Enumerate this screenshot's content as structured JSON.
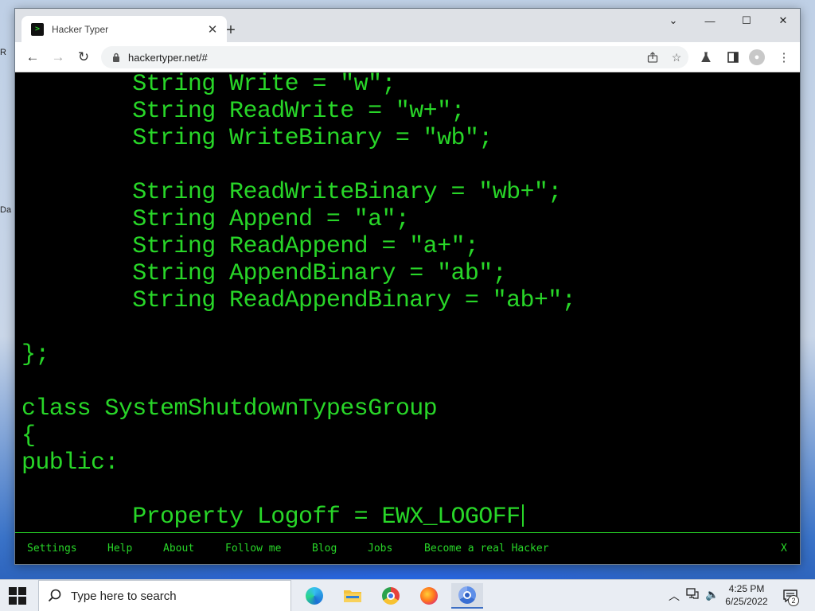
{
  "desktop": {
    "fragments": [
      "R",
      "Da"
    ]
  },
  "browser": {
    "tab_title": "Hacker Typer",
    "favicon_glyph": ">",
    "tab_close": "✕",
    "new_tab": "+",
    "window_controls": {
      "minimize": "—",
      "maximize": "☐",
      "close": "✕",
      "tabs_menu": "⌄"
    },
    "url": "hackertyper.net/#",
    "nav": {
      "back": "←",
      "forward": "→",
      "reload": "↻"
    }
  },
  "terminal": {
    "text_color": "#28d628",
    "lines": [
      "        String Write = \"w\";",
      "        String ReadWrite = \"w+\";",
      "        String WriteBinary = \"wb\";",
      "",
      "        String ReadWriteBinary = \"wb+\";",
      "        String Append = \"a\";",
      "        String ReadAppend = \"a+\";",
      "        String AppendBinary = \"ab\";",
      "        String ReadAppendBinary = \"ab+\";",
      "",
      "};",
      "",
      "class SystemShutdownTypesGroup",
      "{",
      "public:",
      "",
      "        Property Logoff = EWX_LOGOFF"
    ]
  },
  "menu": {
    "items": [
      "Settings",
      "Help",
      "About",
      "Follow me",
      "Blog",
      "Jobs",
      "Become a real Hacker"
    ],
    "close": "X"
  },
  "taskbar": {
    "search_placeholder": "Type here to search",
    "apps": [
      "edge-icon",
      "file-explorer-icon",
      "chrome-icon",
      "firefox-icon",
      "chrome-active-icon"
    ],
    "time": "4:25 PM",
    "date": "6/25/2022",
    "notification_count": "2"
  }
}
